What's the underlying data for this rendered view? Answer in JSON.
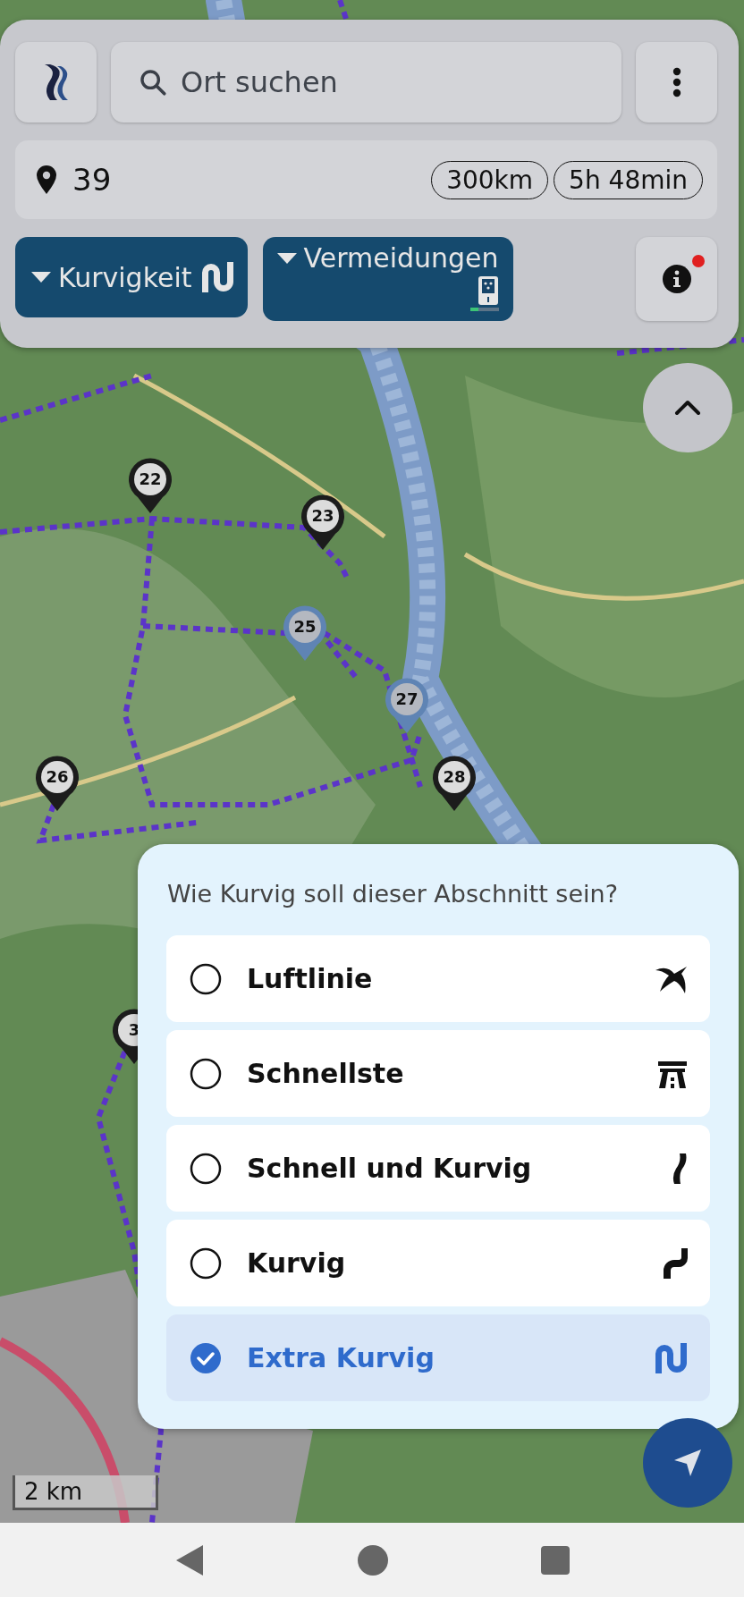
{
  "top_panel": {
    "search": {
      "placeholder": "Ort suchen"
    },
    "waypoints": "39",
    "distance": "300km",
    "duration": "5h 48min",
    "filters": [
      {
        "label": "Kurvigkeit",
        "kind": "curviness"
      },
      {
        "label": "Vermeidungen",
        "kind": "avoidances",
        "level": 0.3
      }
    ],
    "info": {
      "notification": true
    }
  },
  "map": {
    "pins": [
      {
        "label": "22",
        "kind": "plain"
      },
      {
        "label": "23",
        "kind": "plain"
      },
      {
        "label": "25",
        "kind": "highlighted"
      },
      {
        "label": "27",
        "kind": "highlighted"
      },
      {
        "label": "26",
        "kind": "plain"
      },
      {
        "label": "28",
        "kind": "plain"
      },
      {
        "label": "3",
        "kind": "plain"
      }
    ],
    "scale": "2 km"
  },
  "sheet": {
    "title": "Wie Kurvig soll dieser Abschnitt sein?",
    "options": [
      {
        "label": "Luftlinie",
        "kind": "bird",
        "selected": false
      },
      {
        "label": "Schnellste",
        "kind": "motorway",
        "selected": false
      },
      {
        "label": "Schnell und Kurvig",
        "kind": "scurve",
        "selected": false
      },
      {
        "label": "Kurvig",
        "kind": "bend",
        "selected": false
      },
      {
        "label": "Extra Kurvig",
        "kind": "extra",
        "selected": true
      }
    ]
  }
}
